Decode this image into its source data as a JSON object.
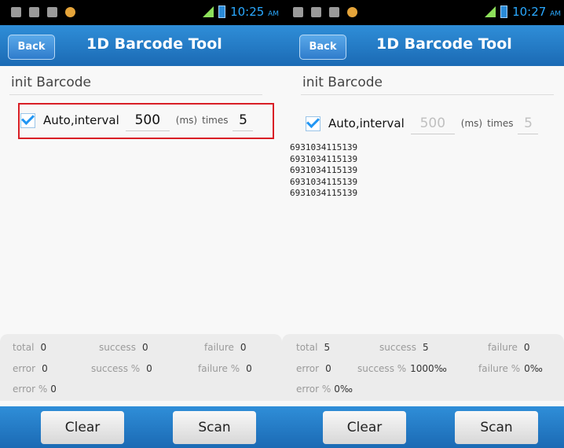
{
  "left": {
    "status": {
      "time": "10:25",
      "ampm": "AM"
    },
    "title_bar": {
      "back_label": "Back",
      "title": "1D Barcode Tool"
    },
    "init_label": "init Barcode",
    "options": {
      "auto_label": "Auto,interval",
      "interval_value": "500",
      "ms_label": "(ms)",
      "times_label": "times",
      "times_value": "5"
    },
    "output": [],
    "stats": {
      "total_label": "total",
      "total": "0",
      "success_label": "success",
      "success": "0",
      "failure_label": "failure",
      "failure": "0",
      "error_label": "error",
      "error": "0",
      "success_pct_label": "success %",
      "success_pct": "0",
      "failure_pct_label": "failure %",
      "failure_pct": "0",
      "error_pct_label": "error %",
      "error_pct": "0"
    },
    "buttons": {
      "clear": "Clear",
      "scan": "Scan"
    }
  },
  "right": {
    "status": {
      "time": "10:27",
      "ampm": "AM"
    },
    "title_bar": {
      "back_label": "Back",
      "title": "1D Barcode Tool"
    },
    "init_label": "init Barcode",
    "options": {
      "auto_label": "Auto,interval",
      "interval_value": "500",
      "ms_label": "(ms)",
      "times_label": "times",
      "times_value": "5"
    },
    "output": [
      "6931034115139",
      "6931034115139",
      "6931034115139",
      "6931034115139",
      "6931034115139"
    ],
    "stats": {
      "total_label": "total",
      "total": "5",
      "success_label": "success",
      "success": "5",
      "failure_label": "failure",
      "failure": "0",
      "error_label": "error",
      "error": "0",
      "success_pct_label": "success %",
      "success_pct": "1000‰",
      "failure_pct_label": "failure %",
      "failure_pct": "0‰",
      "error_pct_label": "error %",
      "error_pct": "0‰"
    },
    "buttons": {
      "clear": "Clear",
      "scan": "Scan"
    }
  },
  "colors": {
    "accent": "#1f78c8",
    "highlight": "#d91f26",
    "check": "#2196f3"
  }
}
